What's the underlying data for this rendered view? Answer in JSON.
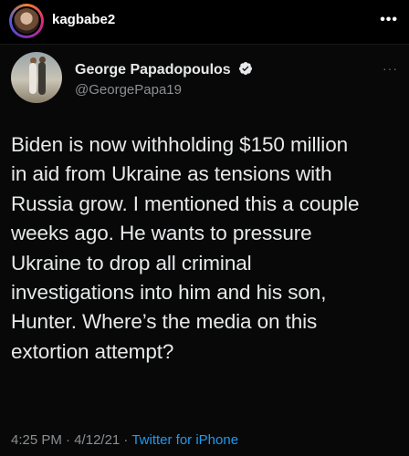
{
  "instagram": {
    "username": "kagbabe2",
    "more": "•••"
  },
  "tweet": {
    "display_name": "George Papadopoulos",
    "handle": "@GeorgePapa19",
    "more": "···",
    "text_lines": [
      "Biden is now withholding $150 million",
      "in aid from Ukraine as tensions with",
      "Russia grow. I mentioned this a couple",
      "weeks ago. He wants to pressure",
      "Ukraine to drop all criminal",
      "investigations into him and his son,",
      "Hunter. Where’s the media on this",
      "extortion attempt?"
    ],
    "time": "4:25 PM",
    "separator1": " · ",
    "date": "4/12/21",
    "separator2": " · ",
    "source": "Twitter for iPhone",
    "colors": {
      "link": "#1d9bf0",
      "verified": "#1d9bf0"
    }
  }
}
